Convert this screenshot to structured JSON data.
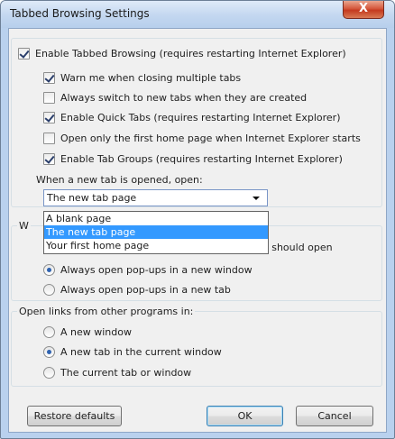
{
  "window": {
    "title": "Tabbed Browsing Settings",
    "close_label": "X"
  },
  "options": {
    "enable_tabbed": "Enable Tabbed Browsing (requires restarting Internet Explorer)",
    "warn_closing": "Warn me when closing multiple tabs",
    "always_switch": "Always switch to new tabs when they are created",
    "quick_tabs": "Enable Quick Tabs (requires restarting Internet Explorer)",
    "open_first_home": "Open only the first home page when Internet Explorer starts",
    "tab_groups": "Enable Tab Groups (requires restarting Internet Explorer)"
  },
  "new_tab": {
    "label": "When a new tab is opened, open:",
    "selected": "The new tab page",
    "options": [
      "A blank page",
      "The new tab page",
      "Your first home page"
    ]
  },
  "popups": {
    "legend": "W",
    "legend_tail": "s should open",
    "options": [
      "Always open pop-ups in a new window",
      "Always open pop-ups in a new tab"
    ]
  },
  "links": {
    "legend": "Open links from other programs in:",
    "options": [
      "A new window",
      "A new tab in the current window",
      "The current tab or window"
    ]
  },
  "buttons": {
    "restore": "Restore defaults",
    "ok": "OK",
    "cancel": "Cancel"
  }
}
